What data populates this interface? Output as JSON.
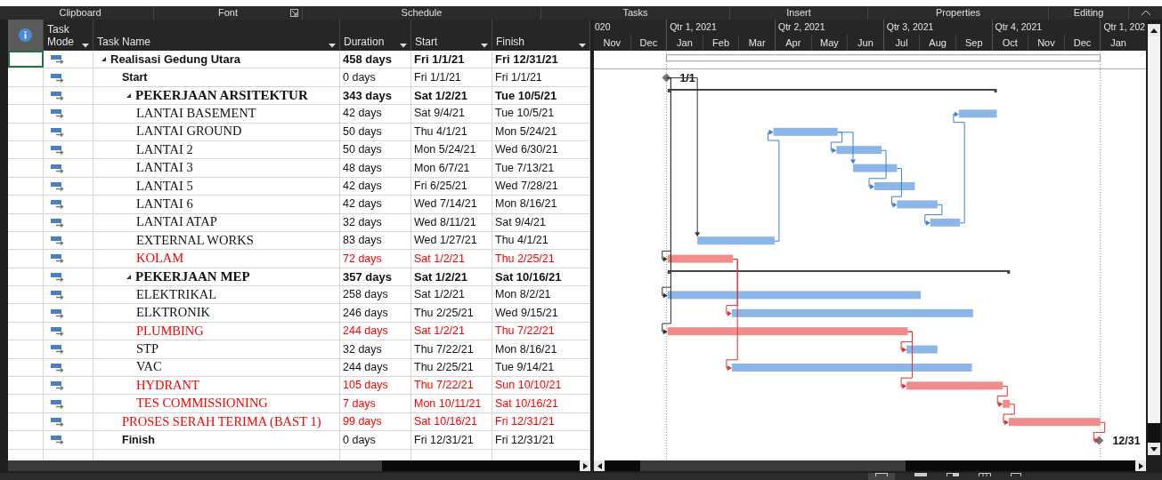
{
  "ribbon_groups": [
    {
      "label": "Clipboard",
      "launcher": false
    },
    {
      "label": "Font",
      "launcher": true
    },
    {
      "label": "Schedule",
      "launcher": false
    },
    {
      "label": "Tasks",
      "launcher": false
    },
    {
      "label": "Insert",
      "launcher": false
    },
    {
      "label": "Properties",
      "launcher": false
    },
    {
      "label": "Editing",
      "launcher": false
    }
  ],
  "columns": [
    {
      "label": "Task Mode"
    },
    {
      "label": "Task Name"
    },
    {
      "label": "Duration"
    },
    {
      "label": "Start"
    },
    {
      "label": "Finish"
    }
  ],
  "timescale": {
    "quarters": [
      {
        "label": "020",
        "months": [
          "Nov",
          "Dec"
        ]
      },
      {
        "label": "Qtr 1, 2021",
        "months": [
          "Jan",
          "Feb",
          "Mar"
        ]
      },
      {
        "label": "Qtr 2, 2021",
        "months": [
          "Apr",
          "May",
          "Jun"
        ]
      },
      {
        "label": "Qtr 3, 2021",
        "months": [
          "Jul",
          "Aug",
          "Sep"
        ]
      },
      {
        "label": "Qtr 4, 2021",
        "months": [
          "Oct",
          "Nov",
          "Dec"
        ]
      },
      {
        "label": "Qtr 1, 202",
        "months": [
          "Jan"
        ]
      }
    ]
  },
  "tasks": [
    {
      "kind": "project",
      "name": "Realisasi Gedung Utara",
      "duration": "458 days",
      "start": "Fri 1/1/21",
      "finish": "Fri 12/31/21",
      "critical": false,
      "selected": true,
      "expanded": true,
      "children": [
        {
          "kind": "milestone",
          "name": "Start",
          "duration": "0 days",
          "start": "Fri 1/1/21",
          "finish": "Fri 1/1/21",
          "critical": false,
          "selected": false,
          "label": "1/1"
        },
        {
          "kind": "summary",
          "name": "PEKERJAAN ARSITEKTUR",
          "duration": "343 days",
          "start": "Sat 1/2/21",
          "finish": "Tue 10/5/21",
          "critical": false,
          "selected": false,
          "expanded": true,
          "children": [
            {
              "kind": "task",
              "name": "LANTAI BASEMENT",
              "duration": "42 days",
              "start": "Sat 9/4/21",
              "finish": "Tue 10/5/21",
              "critical": false,
              "selected": false
            },
            {
              "kind": "task",
              "name": "LANTAI GROUND",
              "duration": "50 days",
              "start": "Thu 4/1/21",
              "finish": "Mon 5/24/21",
              "critical": false,
              "selected": false
            },
            {
              "kind": "task",
              "name": "LANTAI 2",
              "duration": "50 days",
              "start": "Mon 5/24/21",
              "finish": "Wed 6/30/21",
              "critical": false,
              "selected": false
            },
            {
              "kind": "task",
              "name": "LANTAI 3",
              "duration": "48 days",
              "start": "Mon 6/7/21",
              "finish": "Tue 7/13/21",
              "critical": false,
              "selected": false
            },
            {
              "kind": "task",
              "name": "LANTAI 5",
              "duration": "42 days",
              "start": "Fri 6/25/21",
              "finish": "Wed 7/28/21",
              "critical": false,
              "selected": false
            },
            {
              "kind": "task",
              "name": "LANTAI 6",
              "duration": "42 days",
              "start": "Wed 7/14/21",
              "finish": "Mon 8/16/21",
              "critical": false,
              "selected": false
            },
            {
              "kind": "task",
              "name": "LANTAI ATAP",
              "duration": "32 days",
              "start": "Wed 8/11/21",
              "finish": "Sat 9/4/21",
              "critical": false,
              "selected": false
            },
            {
              "kind": "task",
              "name": "EXTERNAL WORKS",
              "duration": "83 days",
              "start": "Wed 1/27/21",
              "finish": "Thu 4/1/21",
              "critical": false,
              "selected": false
            },
            {
              "kind": "task",
              "name": "KOLAM",
              "duration": "72 days",
              "start": "Sat 1/2/21",
              "finish": "Thu 2/25/21",
              "critical": true,
              "selected": false
            }
          ]
        },
        {
          "kind": "summary",
          "name": "PEKERJAAN MEP",
          "duration": "357 days",
          "start": "Sat 1/2/21",
          "finish": "Sat 10/16/21",
          "critical": false,
          "selected": false,
          "expanded": true,
          "children": [
            {
              "kind": "task",
              "name": "ELEKTRIKAL",
              "duration": "258 days",
              "start": "Sat 1/2/21",
              "finish": "Mon 8/2/21",
              "critical": false,
              "selected": false
            },
            {
              "kind": "task",
              "name": "ELKTRONIK",
              "duration": "246 days",
              "start": "Thu 2/25/21",
              "finish": "Wed 9/15/21",
              "critical": false,
              "selected": false
            },
            {
              "kind": "task",
              "name": "PLUMBING",
              "duration": "244 days",
              "start": "Sat 1/2/21",
              "finish": "Thu 7/22/21",
              "critical": true,
              "selected": false
            },
            {
              "kind": "task",
              "name": "STP",
              "duration": "32 days",
              "start": "Thu 7/22/21",
              "finish": "Mon 8/16/21",
              "critical": false,
              "selected": false
            },
            {
              "kind": "task",
              "name": "VAC",
              "duration": "244 days",
              "start": "Thu 2/25/21",
              "finish": "Tue 9/14/21",
              "critical": false,
              "selected": false
            },
            {
              "kind": "task",
              "name": "HYDRANT",
              "duration": "105 days",
              "start": "Thu 7/22/21",
              "finish": "Sun 10/10/21",
              "critical": true,
              "selected": false
            },
            {
              "kind": "task",
              "name": "TES COMMISSIONING",
              "duration": "7 days",
              "start": "Mon 10/11/21",
              "finish": "Sat 10/16/21",
              "critical": true,
              "selected": false
            }
          ]
        },
        {
          "kind": "task",
          "name": "PROSES SERAH TERIMA (BAST 1)",
          "duration": "99 days",
          "start": "Sat 10/16/21",
          "finish": "Fri 12/31/21",
          "critical": true,
          "selected": false
        },
        {
          "kind": "milestone",
          "name": "Finish",
          "duration": "0 days",
          "start": "Fri 12/31/21",
          "finish": "Fri 12/31/21",
          "critical": false,
          "selected": false,
          "label": "12/31"
        }
      ]
    }
  ]
}
